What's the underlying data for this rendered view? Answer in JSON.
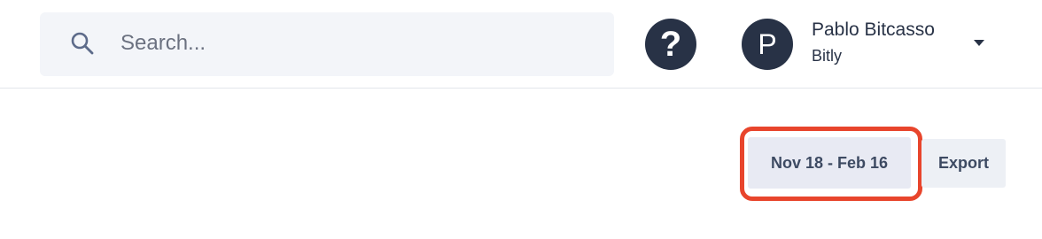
{
  "header": {
    "search": {
      "placeholder": "Search...",
      "icon": "search-icon"
    },
    "help": {
      "glyph": "?",
      "icon": "help-icon"
    },
    "user": {
      "avatar_initial": "P",
      "name": "Pablo Bitcasso",
      "organization": "Bitly",
      "menu_icon": "chevron-down-icon"
    }
  },
  "toolbar": {
    "date_range_label": "Nov 18 - Feb 16",
    "export_label": "Export",
    "highlight_color": "#e8452c"
  },
  "colors": {
    "dark_navy": "#283246",
    "search_bg": "#f3f5f9",
    "button_bg": "#e8eaf3"
  }
}
